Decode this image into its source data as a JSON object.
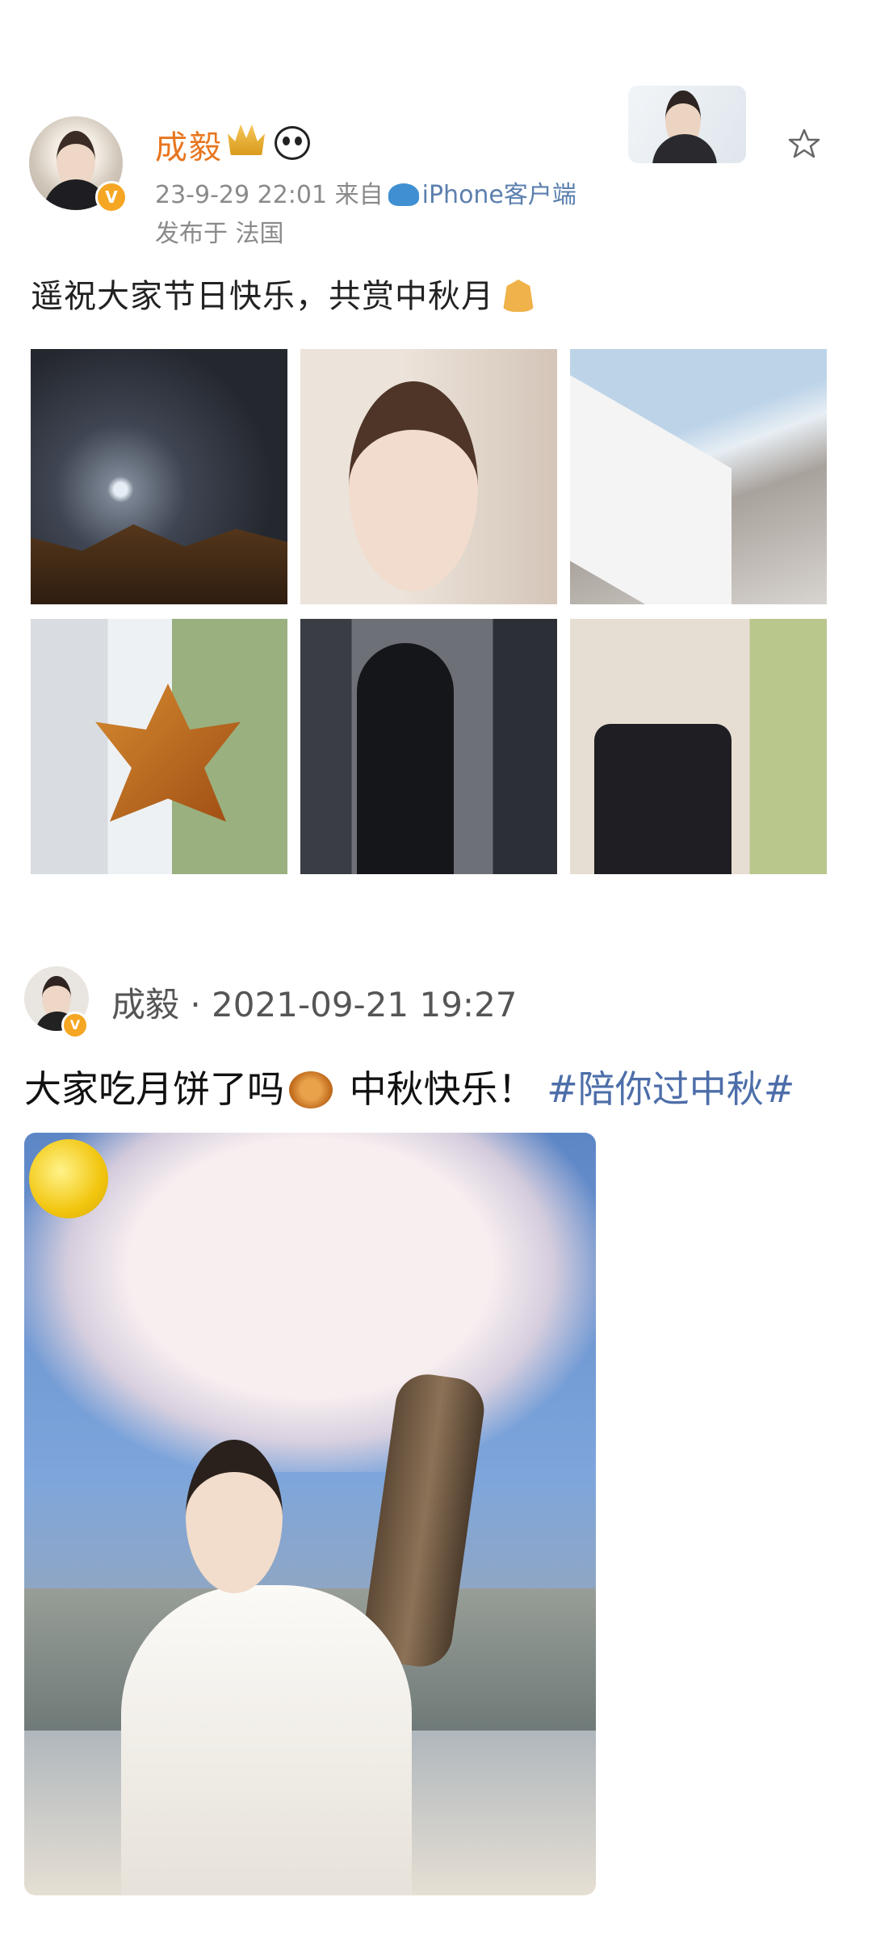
{
  "post1": {
    "username": "成毅",
    "timestamp": "23-9-29 22:01",
    "source_prefix": "来自",
    "source_client": "iPhone客户端",
    "location": "发布于 法国",
    "text": "遥祝大家节日快乐，共赏中秋月",
    "icons": [
      "crown-icon",
      "panda-icon",
      "whale-icon",
      "star-icon",
      "hands-icon",
      "verified-icon"
    ],
    "images": [
      "moon-night-photo",
      "profile-photo",
      "window-reflection-photo",
      "maple-leaf-photo",
      "black-suit-photo",
      "seated-photo"
    ]
  },
  "post2": {
    "author_line": "成毅 · 2021-09-21 19:27",
    "text_main": "大家吃月饼了吗",
    "text_after": " 中秋快乐！ ",
    "hashtag": "#陪你过中秋#",
    "icons": [
      "mooncake-icon",
      "moon-icon",
      "verified-icon"
    ],
    "image": "mooncake-costume-photo"
  },
  "colors": {
    "username": "#e8761f",
    "meta": "#8a8a8a",
    "link": "#5b7fae",
    "hashtag": "#4d6ea9",
    "verified": "#f5a623"
  }
}
